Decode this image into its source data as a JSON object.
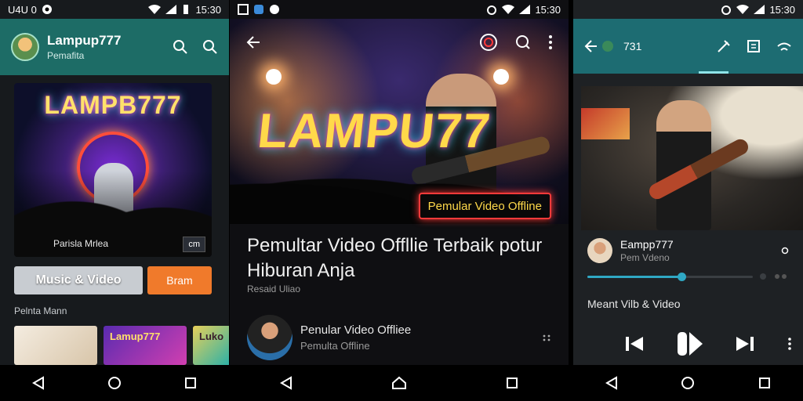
{
  "screen1": {
    "status": {
      "left": "U4U 0",
      "time": "15:30"
    },
    "app_title": "Lampup777",
    "app_subtitle": "Pemafita",
    "art": {
      "neon_title": "LAMPB777",
      "caption": "Parisla Mrlea",
      "badge": "cm"
    },
    "buttons": {
      "music_video": "Music & Video",
      "primary": "Bram"
    },
    "section_title": "Pelnta Mann",
    "thumbs": [
      "",
      "Lamup777",
      "Luko"
    ]
  },
  "screen2": {
    "status": {
      "time": "15:30"
    },
    "hero": {
      "neon_title": "LAMPU77",
      "badge": "Pemular Video Offline"
    },
    "video_title": "Pemultar Video Offllie Terbaik potur Hiburan Anja",
    "video_meta": "Resaid Uliao",
    "channel": {
      "name": "Penular Video Offliee",
      "subtitle": "Pemulta Offline"
    }
  },
  "screen3": {
    "status": {
      "time": "15:30"
    },
    "bar_title": "731",
    "track": {
      "name": "Eampp777",
      "subtitle": "Pem Vdeno"
    },
    "progress": 0.57,
    "now_playing_label": "Meant Vilb & Video"
  },
  "colors": {
    "teal": "#1d6c66",
    "orange": "#f07a2b",
    "accent": "#2fa8c4"
  },
  "icons": [
    "search-icon",
    "back-icon",
    "cast-icon",
    "more-icon",
    "skip-previous-icon",
    "play-pause-icon",
    "skip-next-icon",
    "nav-back-icon",
    "nav-home-icon",
    "nav-recents-icon"
  ]
}
